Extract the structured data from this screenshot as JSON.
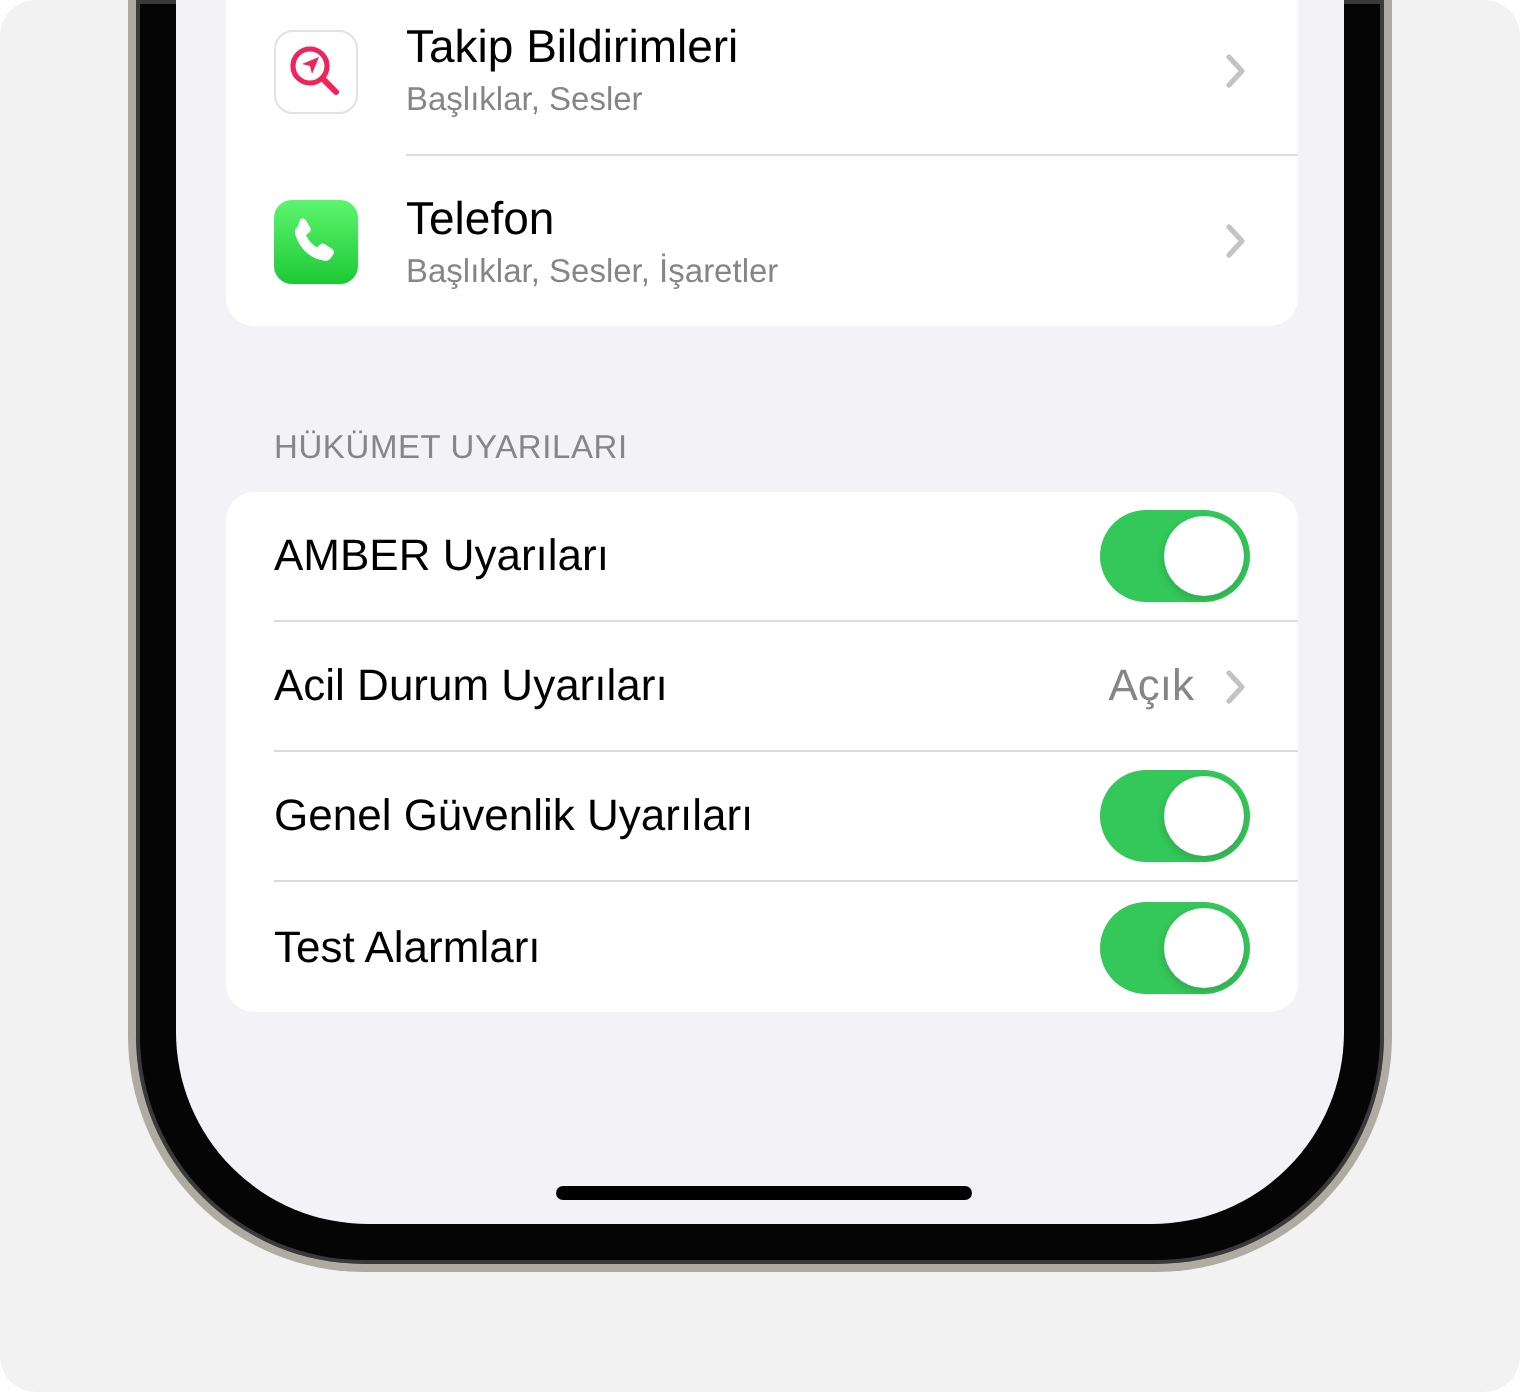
{
  "apps_list": {
    "items": [
      {
        "title": "Takip Bildirimleri",
        "subtitle": "Başlıklar, Sesler"
      },
      {
        "title": "Telefon",
        "subtitle": "Başlıklar, Sesler, İşaretler"
      }
    ]
  },
  "government_alerts": {
    "header": "HÜKÜMET UYARILARI",
    "rows": [
      {
        "kind": "toggle",
        "label": "AMBER Uyarıları",
        "on": true
      },
      {
        "kind": "link",
        "label": "Acil Durum Uyarıları",
        "value": "Açık"
      },
      {
        "kind": "toggle",
        "label": "Genel Güvenlik Uyarıları",
        "on": true
      },
      {
        "kind": "toggle",
        "label": "Test Alarmları",
        "on": true
      }
    ]
  }
}
